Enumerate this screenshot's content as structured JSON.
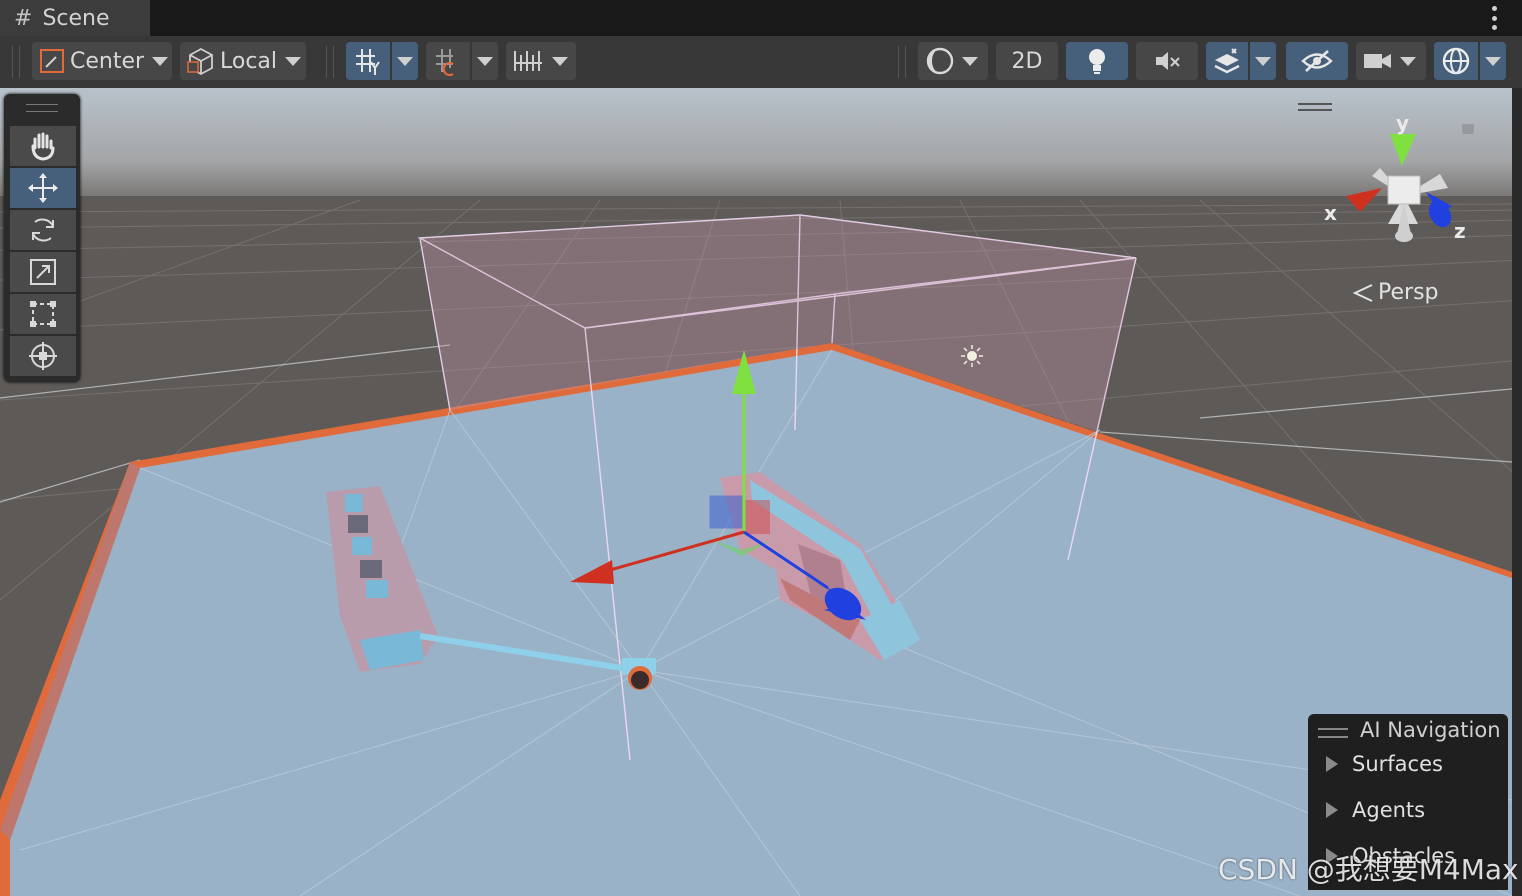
{
  "window": {
    "tab_label": "Scene"
  },
  "toolbar": {
    "pivot_mode": "Center",
    "pivot_rotation": "Local",
    "mode_2d": "2D"
  },
  "view": {
    "projection": "Persp",
    "gizmo_axes": {
      "x": "x",
      "y": "y",
      "z": "z"
    }
  },
  "overlay": {
    "title": "AI Navigation",
    "items": [
      "Surfaces",
      "Agents",
      "Obstacles"
    ]
  },
  "watermark": "CSDN @我想要M4Max",
  "colors": {
    "accent_active": "#46607c",
    "navmesh": "#9ab2c8",
    "selection_outline": "#e06a3a",
    "axis_x": "#d03020",
    "axis_y": "#80e040",
    "axis_z": "#2040e0"
  },
  "icons": {
    "tools": [
      "hand-icon",
      "move-icon",
      "rotate-icon",
      "scale-icon",
      "rect-icon",
      "transform-icon"
    ]
  }
}
